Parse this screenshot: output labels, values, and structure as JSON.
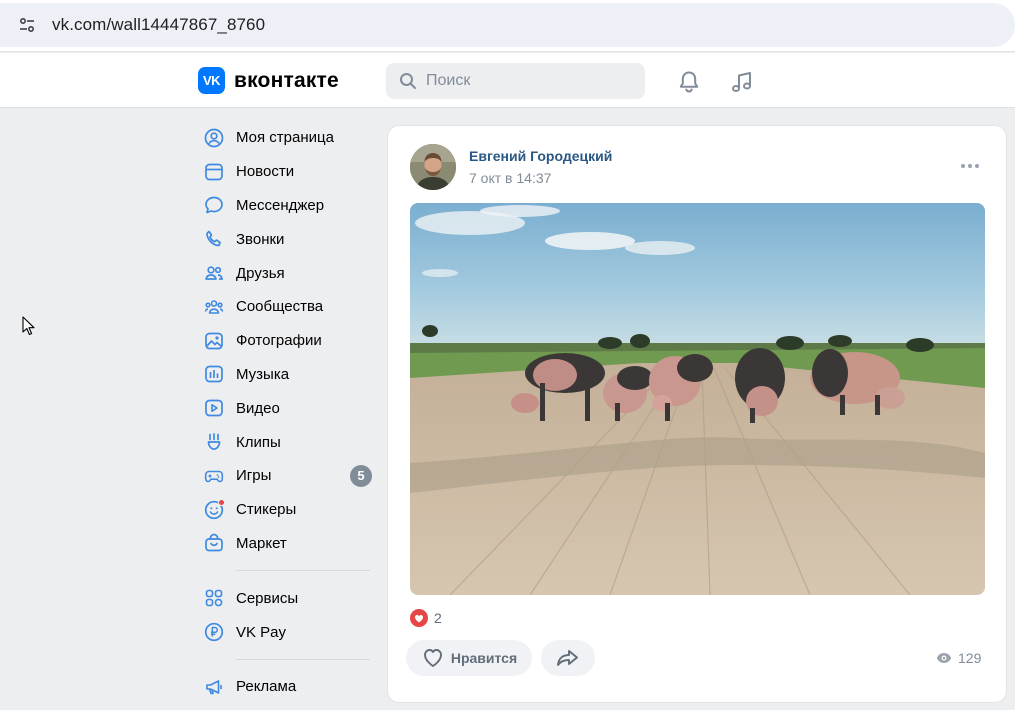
{
  "browser": {
    "url": "vk.com/wall14447867_8760"
  },
  "header": {
    "logo_mark": "VK",
    "logo_text": "вконтакте",
    "search_placeholder": "Поиск"
  },
  "sidebar": {
    "items": [
      {
        "label": "Моя страница",
        "icon": "profile-icon"
      },
      {
        "label": "Новости",
        "icon": "news-icon"
      },
      {
        "label": "Мессенджер",
        "icon": "messenger-icon"
      },
      {
        "label": "Звонки",
        "icon": "phone-icon"
      },
      {
        "label": "Друзья",
        "icon": "friends-icon"
      },
      {
        "label": "Сообщества",
        "icon": "communities-icon"
      },
      {
        "label": "Фотографии",
        "icon": "photos-icon"
      },
      {
        "label": "Музыка",
        "icon": "music-icon"
      },
      {
        "label": "Видео",
        "icon": "video-icon"
      },
      {
        "label": "Клипы",
        "icon": "clips-icon"
      },
      {
        "label": "Игры",
        "icon": "games-icon",
        "badge": "5"
      },
      {
        "label": "Стикеры",
        "icon": "stickers-icon"
      },
      {
        "label": "Маркет",
        "icon": "market-icon"
      }
    ],
    "items2": [
      {
        "label": "Сервисы",
        "icon": "services-icon"
      },
      {
        "label": "VK Pay",
        "icon": "vkpay-icon"
      }
    ],
    "items3": [
      {
        "label": "Реклама",
        "icon": "ads-icon"
      }
    ]
  },
  "post": {
    "author": "Евгений Городецкий",
    "date": "7 окт в 14:37",
    "likes_count": "2",
    "like_label": "Нравится",
    "views_count": "129"
  },
  "colors": {
    "accent": "#0077ff",
    "link": "#2a5885",
    "secondary_text": "#818c99",
    "like_red": "#e64646"
  }
}
